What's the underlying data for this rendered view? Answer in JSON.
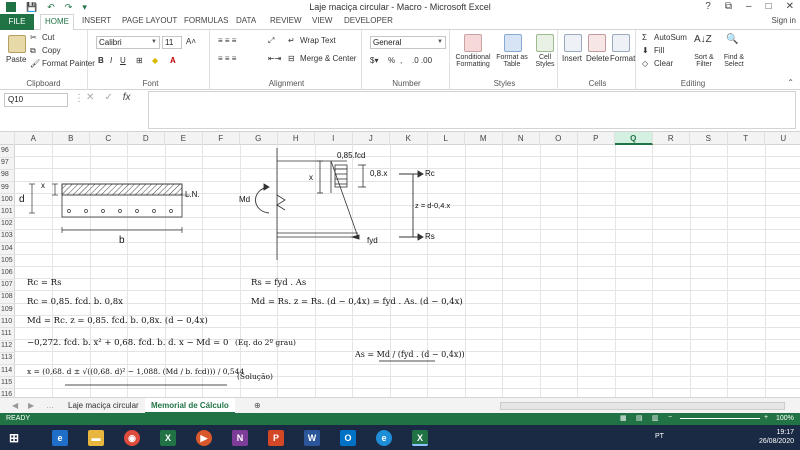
{
  "window": {
    "title": "Laje maciça circular - Macro - Microsoft Excel",
    "help": "?",
    "restore": "⧉",
    "minimize": "–",
    "maximize": "□",
    "close": "✕"
  },
  "tabs": {
    "file": "FILE",
    "home": "HOME",
    "insert": "INSERT",
    "page_layout": "PAGE LAYOUT",
    "formulas": "FORMULAS",
    "data": "DATA",
    "review": "REVIEW",
    "view": "VIEW",
    "developer": "DEVELOPER",
    "sign_in": "Sign in"
  },
  "ribbon": {
    "clipboard": {
      "label": "Clipboard",
      "paste": "Paste",
      "cut": "Cut",
      "copy": "Copy",
      "format_painter": "Format Painter"
    },
    "font": {
      "label": "Font",
      "family": "Calibri",
      "size": "11",
      "bold": "B",
      "italic": "I",
      "underline": "U"
    },
    "alignment": {
      "label": "Alignment",
      "wrap_text": "Wrap Text",
      "merge_center": "Merge & Center"
    },
    "number": {
      "label": "Number",
      "format": "General",
      "percent": "%",
      "comma": ","
    },
    "styles": {
      "label": "Styles",
      "conditional": "Conditional Formatting",
      "format_as": "Format as Table",
      "cell_styles": "Cell Styles"
    },
    "cells": {
      "label": "Cells",
      "insert": "Insert",
      "delete": "Delete",
      "format": "Format"
    },
    "editing": {
      "label": "Editing",
      "autosum": "AutoSum",
      "fill": "Fill",
      "clear": "Clear",
      "sort": "Sort & Filter",
      "find": "Find & Select"
    }
  },
  "formula_bar": {
    "name_box": "Q10",
    "fx": "fx",
    "value": ""
  },
  "columns": [
    "A",
    "B",
    "C",
    "D",
    "E",
    "F",
    "G",
    "H",
    "I",
    "J",
    "K",
    "L",
    "M",
    "N",
    "O",
    "P",
    "Q",
    "R",
    "S",
    "T",
    "U"
  ],
  "selected_column": "Q",
  "rows": [
    "96",
    "97",
    "98",
    "99",
    "100",
    "101",
    "102",
    "103",
    "104",
    "105",
    "106",
    "107",
    "108",
    "109",
    "110",
    "111",
    "112",
    "113",
    "114",
    "115",
    "116"
  ],
  "diagram": {
    "x_label": "x",
    "d_label": "d",
    "ln_label": "L.N.",
    "b_label": "b",
    "md_label": "Md",
    "fcd_label": "0,85.fcd",
    "x08_label": "0,8.x",
    "rc_label": "Rc",
    "z_label": "z = d-0,4.x",
    "rs_label": "Rs",
    "fyd_label": "fyd",
    "x2_label": "x"
  },
  "formulas": {
    "f1": "Rc = Rs",
    "f2": "Rc = 0,85. fcd. b. 0,8x",
    "f3": "Md = Rc. z = 0,85. fcd. b. 0,8x. (d − 0,4x)",
    "f4": "−0,272. fcd. b. x² + 0,68. fcd. b. d. x − Md = 0",
    "f4_note": "(Eq. do 2º grau)",
    "f5": "x = (0,68. d ± √((0,68. d)² − 1,088. (Md / b. fcd))) / 0,544",
    "f5_note": "(Solução)",
    "f6": "Rs = fyd . As",
    "f7": "Md = Rs. z = Rs. (d − 0,4x) = fyd . As. (d − 0,4x)",
    "f8": "As = Md / (fyd . (d − 0,4x))"
  },
  "sheets": [
    "Laje maciça circular",
    "Memorial de Cálculo"
  ],
  "active_sheet": "Memorial de Cálculo",
  "status": {
    "ready": "READY",
    "zoom": "100%"
  },
  "taskbar": {
    "lang": "PT",
    "time": "19:17",
    "date": "26/08/2020"
  },
  "colors": {
    "excel_green": "#217346",
    "taskbar": "#1b2a44"
  }
}
